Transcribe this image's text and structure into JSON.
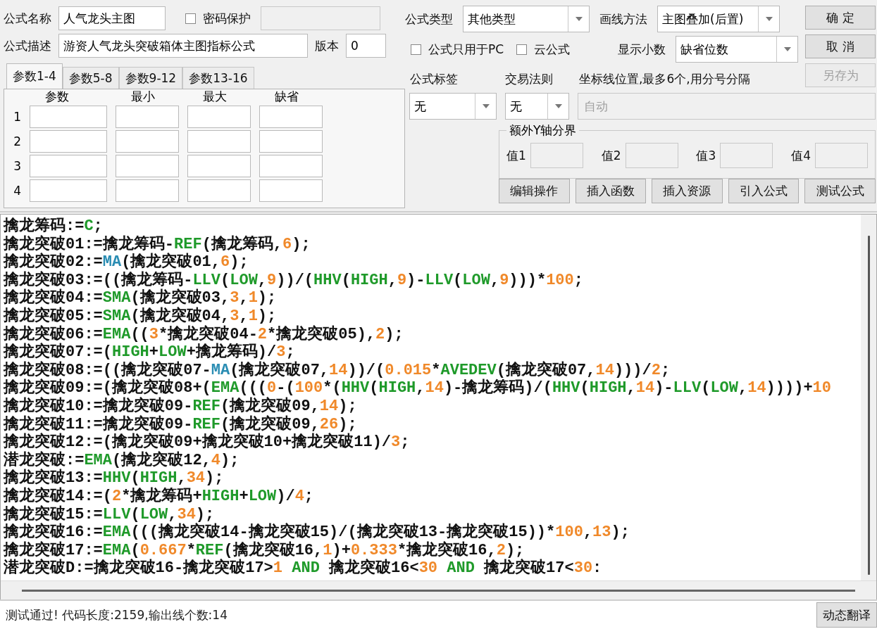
{
  "name_field": {
    "label": "公式名称",
    "value": "人气龙头主图"
  },
  "password": {
    "label": "密码保护",
    "checked": false
  },
  "description_field": {
    "label": "公式描述",
    "value": "游资人气龙头突破箱体主图指标公式"
  },
  "version_field": {
    "label": "版本",
    "value": "0"
  },
  "param_tabs": [
    {
      "label": "参数1-4",
      "selected": true
    },
    {
      "label": "参数5-8",
      "selected": false
    },
    {
      "label": "参数9-12",
      "selected": false
    },
    {
      "label": "参数13-16",
      "selected": false
    }
  ],
  "param_table": {
    "columns": [
      "参数",
      "最小",
      "最大",
      "缺省"
    ],
    "rows": [
      "1",
      "2",
      "3",
      "4"
    ]
  },
  "formula_type": {
    "label": "公式类型",
    "value": "其他类型"
  },
  "draw_method": {
    "label": "画线方法",
    "value": "主图叠加(后置)"
  },
  "options": [
    {
      "label": "公式只用于PC",
      "checked": false
    },
    {
      "label": "云公式",
      "checked": false
    }
  ],
  "decimals": {
    "label": "显示小数",
    "value": "缺省位数"
  },
  "side_buttons": [
    {
      "label": "确 定",
      "disabled": false
    },
    {
      "label": "取 消",
      "disabled": false
    },
    {
      "label": "另存为",
      "disabled": true
    }
  ],
  "formula_tag": {
    "label": "公式标签",
    "value": "无"
  },
  "trade_rule": {
    "label": "交易法则",
    "value": "无"
  },
  "axis_lines": {
    "label": "坐标线位置,最多6个,用分号分隔",
    "placeholder": "自动"
  },
  "y_axis": {
    "title": "额外Y轴分界",
    "fields": [
      "值1",
      "值2",
      "值3",
      "值4"
    ]
  },
  "action_buttons": [
    "编辑操作",
    "插入函数",
    "插入资源",
    "引入公式",
    "测试公式"
  ],
  "code_lines": [
    [
      {
        "kind": "plain",
        "text": "擒龙筹码:="
      },
      {
        "kind": "func",
        "text": "C"
      },
      {
        "kind": "plain",
        "text": ";"
      }
    ],
    [
      {
        "kind": "plain",
        "text": "擒龙突破01:=擒龙筹码-"
      },
      {
        "kind": "func",
        "text": "REF"
      },
      {
        "kind": "plain",
        "text": "(擒龙筹码,"
      },
      {
        "kind": "num",
        "text": "6"
      },
      {
        "kind": "plain",
        "text": ");"
      }
    ],
    [
      {
        "kind": "plain",
        "text": "擒龙突破02:="
      },
      {
        "kind": "ma",
        "text": "MA"
      },
      {
        "kind": "plain",
        "text": "(擒龙突破01,"
      },
      {
        "kind": "num",
        "text": "6"
      },
      {
        "kind": "plain",
        "text": ");"
      }
    ],
    [
      {
        "kind": "plain",
        "text": "擒龙突破03:=((擒龙筹码-"
      },
      {
        "kind": "func",
        "text": "LLV"
      },
      {
        "kind": "plain",
        "text": "("
      },
      {
        "kind": "func",
        "text": "LOW"
      },
      {
        "kind": "plain",
        "text": ","
      },
      {
        "kind": "num",
        "text": "9"
      },
      {
        "kind": "plain",
        "text": "))/("
      },
      {
        "kind": "func",
        "text": "HHV"
      },
      {
        "kind": "plain",
        "text": "("
      },
      {
        "kind": "func",
        "text": "HIGH"
      },
      {
        "kind": "plain",
        "text": ","
      },
      {
        "kind": "num",
        "text": "9"
      },
      {
        "kind": "plain",
        "text": ")-"
      },
      {
        "kind": "func",
        "text": "LLV"
      },
      {
        "kind": "plain",
        "text": "("
      },
      {
        "kind": "func",
        "text": "LOW"
      },
      {
        "kind": "plain",
        "text": ","
      },
      {
        "kind": "num",
        "text": "9"
      },
      {
        "kind": "plain",
        "text": ")))*"
      },
      {
        "kind": "num",
        "text": "100"
      },
      {
        "kind": "plain",
        "text": ";"
      }
    ],
    [
      {
        "kind": "plain",
        "text": "擒龙突破04:="
      },
      {
        "kind": "func",
        "text": "SMA"
      },
      {
        "kind": "plain",
        "text": "(擒龙突破03,"
      },
      {
        "kind": "num",
        "text": "3"
      },
      {
        "kind": "plain",
        "text": ","
      },
      {
        "kind": "num",
        "text": "1"
      },
      {
        "kind": "plain",
        "text": ");"
      }
    ],
    [
      {
        "kind": "plain",
        "text": "擒龙突破05:="
      },
      {
        "kind": "func",
        "text": "SMA"
      },
      {
        "kind": "plain",
        "text": "(擒龙突破04,"
      },
      {
        "kind": "num",
        "text": "3"
      },
      {
        "kind": "plain",
        "text": ","
      },
      {
        "kind": "num",
        "text": "1"
      },
      {
        "kind": "plain",
        "text": ");"
      }
    ],
    [
      {
        "kind": "plain",
        "text": "擒龙突破06:="
      },
      {
        "kind": "func",
        "text": "EMA"
      },
      {
        "kind": "plain",
        "text": "(("
      },
      {
        "kind": "num",
        "text": "3"
      },
      {
        "kind": "plain",
        "text": "*擒龙突破04-"
      },
      {
        "kind": "num",
        "text": "2"
      },
      {
        "kind": "plain",
        "text": "*擒龙突破05),"
      },
      {
        "kind": "num",
        "text": "2"
      },
      {
        "kind": "plain",
        "text": ");"
      }
    ],
    [
      {
        "kind": "plain",
        "text": "擒龙突破07:=("
      },
      {
        "kind": "func",
        "text": "HIGH"
      },
      {
        "kind": "plain",
        "text": "+"
      },
      {
        "kind": "func",
        "text": "LOW"
      },
      {
        "kind": "plain",
        "text": "+擒龙筹码)/"
      },
      {
        "kind": "num",
        "text": "3"
      },
      {
        "kind": "plain",
        "text": ";"
      }
    ],
    [
      {
        "kind": "plain",
        "text": "擒龙突破08:=((擒龙突破07-"
      },
      {
        "kind": "ma",
        "text": "MA"
      },
      {
        "kind": "plain",
        "text": "(擒龙突破07,"
      },
      {
        "kind": "num",
        "text": "14"
      },
      {
        "kind": "plain",
        "text": "))/("
      },
      {
        "kind": "num",
        "text": "0.015"
      },
      {
        "kind": "plain",
        "text": "*"
      },
      {
        "kind": "func",
        "text": "AVEDEV"
      },
      {
        "kind": "plain",
        "text": "(擒龙突破07,"
      },
      {
        "kind": "num",
        "text": "14"
      },
      {
        "kind": "plain",
        "text": ")))/"
      },
      {
        "kind": "num",
        "text": "2"
      },
      {
        "kind": "plain",
        "text": ";"
      }
    ],
    [
      {
        "kind": "plain",
        "text": "擒龙突破09:=(擒龙突破08+("
      },
      {
        "kind": "func",
        "text": "EMA"
      },
      {
        "kind": "plain",
        "text": "((("
      },
      {
        "kind": "num",
        "text": "0"
      },
      {
        "kind": "plain",
        "text": "-("
      },
      {
        "kind": "num",
        "text": "100"
      },
      {
        "kind": "plain",
        "text": "*("
      },
      {
        "kind": "func",
        "text": "HHV"
      },
      {
        "kind": "plain",
        "text": "("
      },
      {
        "kind": "func",
        "text": "HIGH"
      },
      {
        "kind": "plain",
        "text": ","
      },
      {
        "kind": "num",
        "text": "14"
      },
      {
        "kind": "plain",
        "text": ")-擒龙筹码)/("
      },
      {
        "kind": "func",
        "text": "HHV"
      },
      {
        "kind": "plain",
        "text": "("
      },
      {
        "kind": "func",
        "text": "HIGH"
      },
      {
        "kind": "plain",
        "text": ","
      },
      {
        "kind": "num",
        "text": "14"
      },
      {
        "kind": "plain",
        "text": ")-"
      },
      {
        "kind": "func",
        "text": "LLV"
      },
      {
        "kind": "plain",
        "text": "("
      },
      {
        "kind": "func",
        "text": "LOW"
      },
      {
        "kind": "plain",
        "text": ","
      },
      {
        "kind": "num",
        "text": "14"
      },
      {
        "kind": "plain",
        "text": "))))+"
      },
      {
        "kind": "num",
        "text": "10"
      }
    ],
    [
      {
        "kind": "plain",
        "text": "擒龙突破10:=擒龙突破09-"
      },
      {
        "kind": "func",
        "text": "REF"
      },
      {
        "kind": "plain",
        "text": "(擒龙突破09,"
      },
      {
        "kind": "num",
        "text": "14"
      },
      {
        "kind": "plain",
        "text": ");"
      }
    ],
    [
      {
        "kind": "plain",
        "text": "擒龙突破11:=擒龙突破09-"
      },
      {
        "kind": "func",
        "text": "REF"
      },
      {
        "kind": "plain",
        "text": "(擒龙突破09,"
      },
      {
        "kind": "num",
        "text": "26"
      },
      {
        "kind": "plain",
        "text": ");"
      }
    ],
    [
      {
        "kind": "plain",
        "text": "擒龙突破12:=(擒龙突破09+擒龙突破10+擒龙突破11)/"
      },
      {
        "kind": "num",
        "text": "3"
      },
      {
        "kind": "plain",
        "text": ";"
      }
    ],
    [
      {
        "kind": "plain",
        "text": "潜龙突破:="
      },
      {
        "kind": "func",
        "text": "EMA"
      },
      {
        "kind": "plain",
        "text": "(擒龙突破12,"
      },
      {
        "kind": "num",
        "text": "4"
      },
      {
        "kind": "plain",
        "text": ");"
      }
    ],
    [
      {
        "kind": "plain",
        "text": "擒龙突破13:="
      },
      {
        "kind": "func",
        "text": "HHV"
      },
      {
        "kind": "plain",
        "text": "("
      },
      {
        "kind": "func",
        "text": "HIGH"
      },
      {
        "kind": "plain",
        "text": ","
      },
      {
        "kind": "num",
        "text": "34"
      },
      {
        "kind": "plain",
        "text": ");"
      }
    ],
    [
      {
        "kind": "plain",
        "text": "擒龙突破14:=("
      },
      {
        "kind": "num",
        "text": "2"
      },
      {
        "kind": "plain",
        "text": "*擒龙筹码+"
      },
      {
        "kind": "func",
        "text": "HIGH"
      },
      {
        "kind": "plain",
        "text": "+"
      },
      {
        "kind": "func",
        "text": "LOW"
      },
      {
        "kind": "plain",
        "text": ")/"
      },
      {
        "kind": "num",
        "text": "4"
      },
      {
        "kind": "plain",
        "text": ";"
      }
    ],
    [
      {
        "kind": "plain",
        "text": "擒龙突破15:="
      },
      {
        "kind": "func",
        "text": "LLV"
      },
      {
        "kind": "plain",
        "text": "("
      },
      {
        "kind": "func",
        "text": "LOW"
      },
      {
        "kind": "plain",
        "text": ","
      },
      {
        "kind": "num",
        "text": "34"
      },
      {
        "kind": "plain",
        "text": ");"
      }
    ],
    [
      {
        "kind": "plain",
        "text": "擒龙突破16:="
      },
      {
        "kind": "func",
        "text": "EMA"
      },
      {
        "kind": "plain",
        "text": "(((擒龙突破14-擒龙突破15)/(擒龙突破13-擒龙突破15))*"
      },
      {
        "kind": "num",
        "text": "100"
      },
      {
        "kind": "plain",
        "text": ","
      },
      {
        "kind": "num",
        "text": "13"
      },
      {
        "kind": "plain",
        "text": ");"
      }
    ],
    [
      {
        "kind": "plain",
        "text": "擒龙突破17:="
      },
      {
        "kind": "func",
        "text": "EMA"
      },
      {
        "kind": "plain",
        "text": "("
      },
      {
        "kind": "num",
        "text": "0.667"
      },
      {
        "kind": "plain",
        "text": "*"
      },
      {
        "kind": "func",
        "text": "REF"
      },
      {
        "kind": "plain",
        "text": "(擒龙突破16,"
      },
      {
        "kind": "num",
        "text": "1"
      },
      {
        "kind": "plain",
        "text": ")+"
      },
      {
        "kind": "num",
        "text": "0.333"
      },
      {
        "kind": "plain",
        "text": "*擒龙突破16,"
      },
      {
        "kind": "num",
        "text": "2"
      },
      {
        "kind": "plain",
        "text": ");"
      }
    ],
    [
      {
        "kind": "plain",
        "text": "潜龙突破D:=擒龙突破16-擒龙突破17>"
      },
      {
        "kind": "num",
        "text": "1"
      },
      {
        "kind": "func",
        "text": " AND"
      },
      {
        "kind": "plain",
        "text": " 擒龙突破16<"
      },
      {
        "kind": "num",
        "text": "30"
      },
      {
        "kind": "func",
        "text": " AND"
      },
      {
        "kind": "plain",
        "text": " 擒龙突破17<"
      },
      {
        "kind": "num",
        "text": "30"
      },
      {
        "kind": "plain",
        "text": ":"
      }
    ]
  ],
  "status": "测试通过! 代码长度:2159,输出线个数:14",
  "translate_button": "动态翻译"
}
